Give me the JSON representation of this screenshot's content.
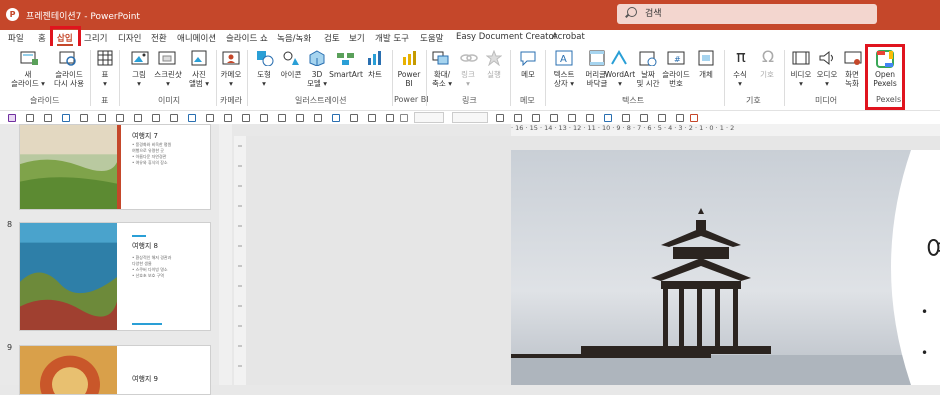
{
  "titlebar": {
    "app_icon_letter": "P",
    "doc_title": "프레젠테이션7 - PowerPoint",
    "search_placeholder": "검색"
  },
  "tabs": [
    "파일",
    "홈",
    "삽입",
    "그리기",
    "디자인",
    "전환",
    "애니메이션",
    "슬라이드 쇼",
    "녹음/녹화",
    "검토",
    "보기",
    "개발 도구",
    "도움말",
    "Easy Document Creator",
    "Acrobat"
  ],
  "active_tab": "삽입",
  "ribbon": {
    "groups": {
      "slides": "슬라이드",
      "tables": "표",
      "images": "이미지",
      "camera": "카메라",
      "illustrations": "일러스트레이션",
      "powerbi": "Power BI",
      "links": "링크",
      "comments": "메모",
      "text": "텍스트",
      "symbols": "기호",
      "media": "미디어",
      "pexels": "Pexels"
    },
    "buttons": {
      "new_slide": "새\n슬라이드 ▾",
      "reuse_slides": "슬라이드\n다시 사용",
      "table": "표\n▾",
      "pictures": "그림\n▾",
      "screenshot": "스크린샷\n▾",
      "photo_album": "사진\n앨범 ▾",
      "cameo": "카메오\n▾",
      "shapes": "도형\n▾",
      "icons": "아이콘",
      "models_3d": "3D\n모델 ▾",
      "smartart": "SmartArt",
      "chart": "차트",
      "powerbi": "Power\nBI",
      "zoom": "확대/\n축소 ▾",
      "link": "링크\n▾",
      "action": "실행",
      "comment": "메모",
      "textbox": "텍스트\n상자 ▾",
      "header_footer": "머리글/\n바닥글",
      "wordart": "WordArt\n▾",
      "date_time": "날짜\n및 시간",
      "slide_number": "슬라이드\n번호",
      "object": "개체",
      "equation": "수식\n▾",
      "symbol": "기호",
      "video": "비디오\n▾",
      "audio": "오디오\n▾",
      "screen_recording": "화면\n녹화",
      "open_pexels": "Open\nPexels"
    }
  },
  "slides_panel": [
    {
      "number": "",
      "title": "여행지 7",
      "bullets": "• 풍경화와 비옥한 평원\n  여행으로 유명한 곳\n• 아름다운 자연경관\n• 여유와 휴식의 장소"
    },
    {
      "number": "8",
      "title": "여행지 8",
      "bullets": "• 환상적인 해저 경관과\n  다양한 생물\n• 스쿠버 다이빙 명소\n• 산호초 보호 구역"
    },
    {
      "number": "9",
      "title": "여행지 9",
      "bullets": ""
    }
  ],
  "ruler": {
    "ticks": "· 16 · 15 · 14 · 13 · 12 · 11 · 10 · 9 · 8 · 7 · 6 · 5 · 4 · 3 · 2 · 1 · 0 · 1 · 2"
  },
  "slide_main": {
    "title_char": "여"
  },
  "colors": {
    "titlebar": "#c5472a",
    "active_tab": "#c5472a",
    "highlight": "#e0141e"
  }
}
